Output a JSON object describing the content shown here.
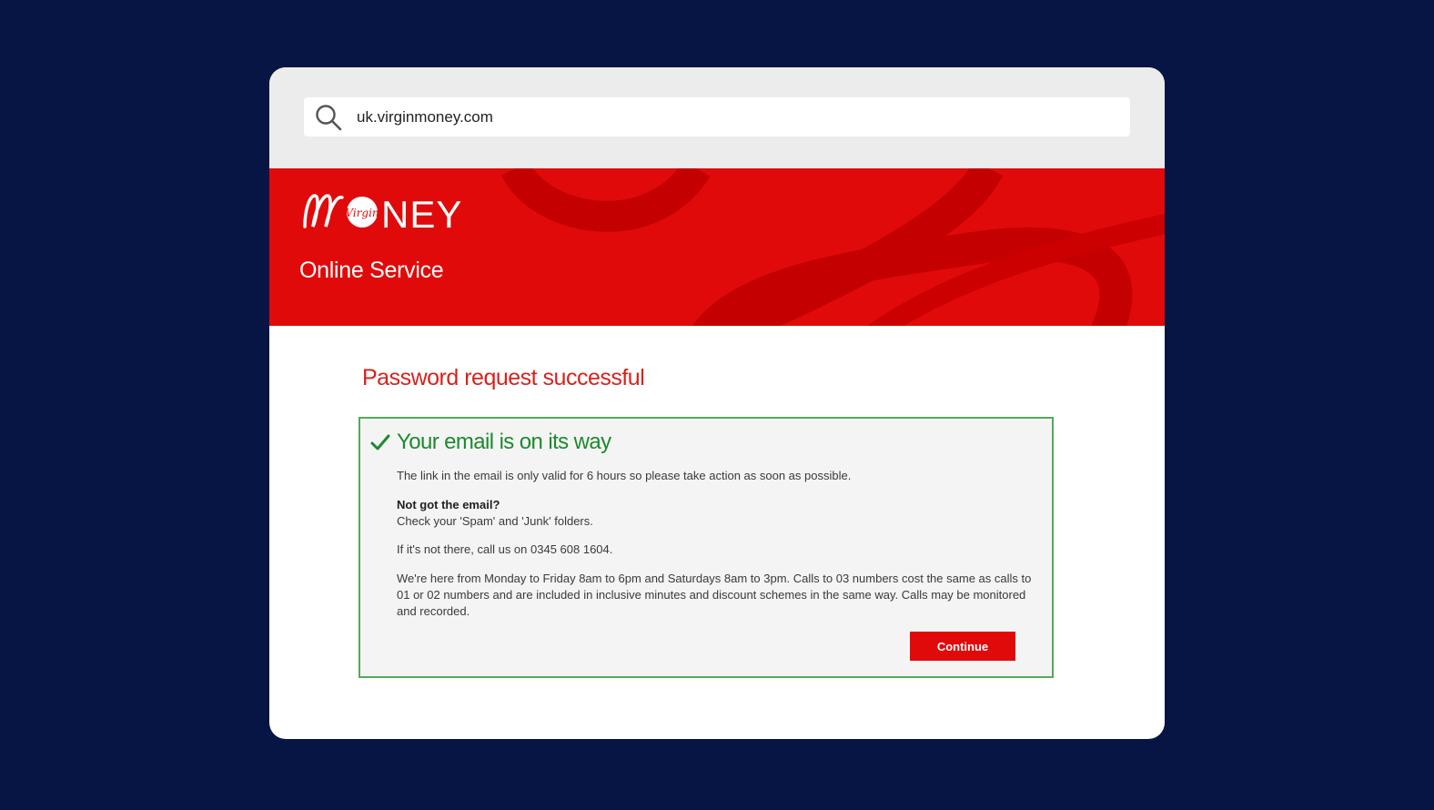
{
  "browser": {
    "url": "uk.virginmoney.com"
  },
  "hero": {
    "logo_text": "MONEY",
    "logo_badge": "Virgin",
    "subtitle": "Online Service"
  },
  "page": {
    "heading": "Password request successful"
  },
  "panel": {
    "title": "Your email is on its way",
    "validity_text": "The link in the email is only valid for 6 hours so please take action as soon as possible.",
    "not_got_heading": "Not got the email?",
    "check_folders_text": "Check your 'Spam' and 'Junk' folders.",
    "call_text": "If it's not there, call us on 0345 608 1604.",
    "hours_text": "We're here from Monday to Friday 8am to 6pm and Saturdays 8am to 3pm. Calls to 03 numbers cost the same as calls to 01 or 02 numbers and are included in inclusive minutes and discount schemes in the same way. Calls may be monitored and recorded.",
    "continue_label": "Continue"
  },
  "colors": {
    "background": "#061544",
    "brand_red": "#e10a0a",
    "success_green": "#1c8a2e",
    "panel_border": "#56a85a"
  },
  "icons": {
    "search": "search-icon",
    "check": "check-icon"
  }
}
